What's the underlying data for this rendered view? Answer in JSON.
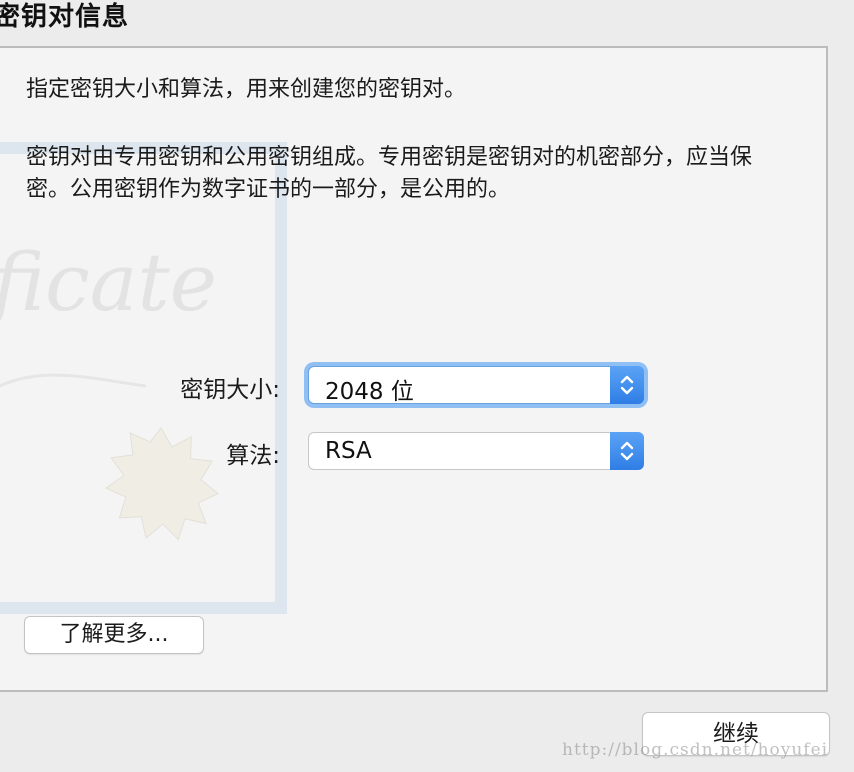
{
  "header": {
    "title": "密钥对信息"
  },
  "panel": {
    "intro": "指定密钥大小和算法，用来创建您的密钥对。",
    "description": "密钥对由专用密钥和公用密钥组成。专用密钥是密钥对的机密部分，应当保密。公用密钥作为数字证书的一部分，是公用的。",
    "background_art_text": "ificate",
    "key_size": {
      "label": "密钥大小:",
      "value": "2048 位"
    },
    "algorithm": {
      "label": "算法:",
      "value": "RSA"
    },
    "learn_more_label": "了解更多..."
  },
  "footer": {
    "continue_label": "继续"
  },
  "watermark": "http://blog.csdn.net/hoyufei",
  "colors": {
    "accent": "#3b8cf0",
    "focus_ring": "#8fbff3",
    "panel_bg": "#f4f4f4",
    "window_bg": "#ececec"
  }
}
